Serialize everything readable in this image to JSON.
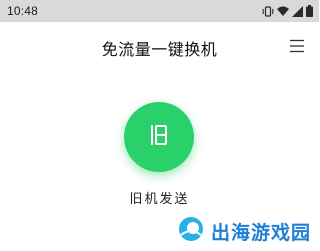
{
  "status_bar": {
    "time": "10:48",
    "background": "#d9d9d9"
  },
  "header": {
    "title": "免流量一键换机"
  },
  "main": {
    "button_icon": "phone-switch-icon",
    "button_color": "#2ad16a",
    "label": "旧机发送"
  },
  "watermark": {
    "text": "出海游戏园",
    "color": "#1e7fd6"
  }
}
